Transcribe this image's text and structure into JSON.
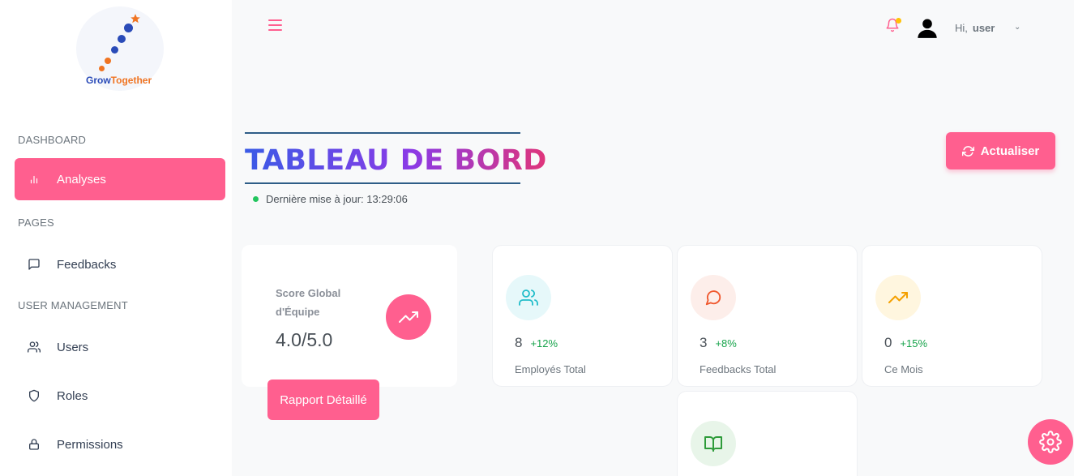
{
  "brand": {
    "logo_text_part1": "Grow",
    "logo_text_part2": "Together"
  },
  "sidebar": {
    "sections": {
      "dashboard": "DASHBOARD",
      "pages": "PAGES",
      "user_management": "USER MANAGEMENT"
    },
    "items": [
      {
        "label": "Analyses",
        "icon": "bar-chart-icon",
        "active": true
      },
      {
        "label": "Feedbacks",
        "icon": "message-square-icon",
        "active": false
      },
      {
        "label": "Users",
        "icon": "users-icon",
        "active": false
      },
      {
        "label": "Roles",
        "icon": "shield-icon",
        "active": false
      },
      {
        "label": "Permissions",
        "icon": "lock-icon",
        "active": false
      }
    ]
  },
  "topbar": {
    "greeting": "Hi,",
    "username": "user",
    "caret": "⌄"
  },
  "header": {
    "title": "TABLEAU DE BORD",
    "last_update": "Dernière mise à jour: 13:29:06",
    "refresh_label": "Actualiser"
  },
  "score": {
    "label": "Score Global d'Équipe",
    "value": "4.0/5.0",
    "report_label": "Rapport Détaillé"
  },
  "stats": [
    {
      "value": "8",
      "delta": "+12%",
      "label": "Employés Total",
      "icon": "users-icon",
      "bg": "#e6f8fa",
      "fg": "#1fbcc9"
    },
    {
      "value": "3",
      "delta": "+8%",
      "label": "Feedbacks Total",
      "icon": "message-circle-icon",
      "bg": "#fdeeea",
      "fg": "#f0582e"
    },
    {
      "value": "0",
      "delta": "+15%",
      "label": "Ce Mois",
      "icon": "trending-up-icon",
      "bg": "#fff6df",
      "fg": "#f4a000"
    },
    {
      "value": "",
      "delta": "",
      "label": "",
      "icon": "book-open-icon",
      "bg": "#e8f5e9",
      "fg": "#2e9b3a"
    }
  ],
  "colors": {
    "accent": "#ff5f8f",
    "status_online": "#22c55e",
    "notification_badge": "#ffc107"
  }
}
